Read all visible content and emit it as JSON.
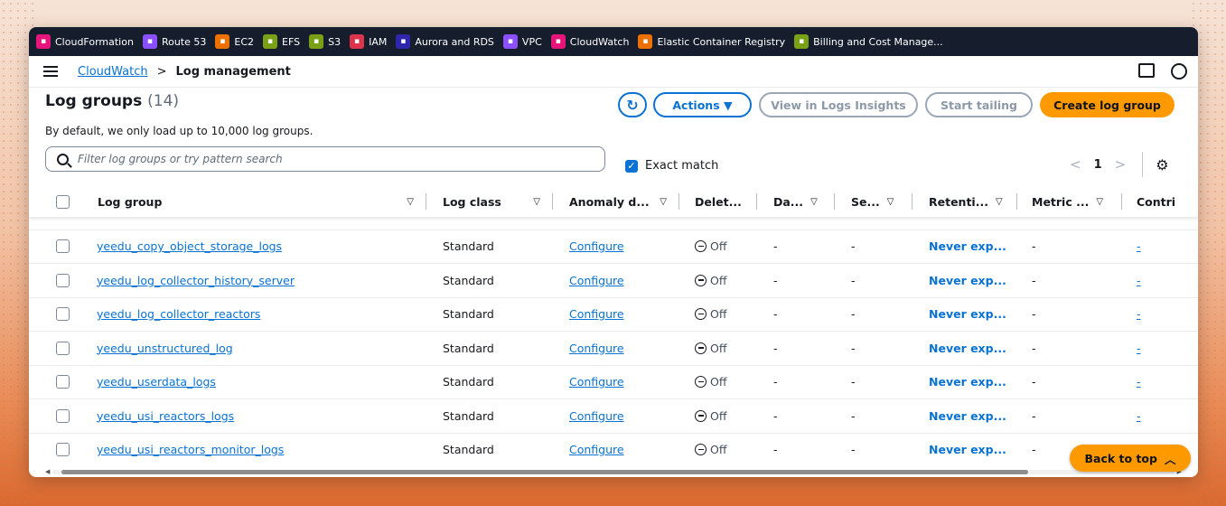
{
  "favorites": [
    {
      "label": "CloudFormation",
      "icon": "cloudformation-icon",
      "color": "#e7157b"
    },
    {
      "label": "Route 53",
      "icon": "route53-icon",
      "color": "#8c4fff"
    },
    {
      "label": "EC2",
      "icon": "ec2-icon",
      "color": "#ed7100"
    },
    {
      "label": "EFS",
      "icon": "efs-icon",
      "color": "#7aa116"
    },
    {
      "label": "S3",
      "icon": "s3-icon",
      "color": "#7aa116"
    },
    {
      "label": "IAM",
      "icon": "iam-icon",
      "color": "#dd344c"
    },
    {
      "label": "Aurora and RDS",
      "icon": "rds-icon",
      "color": "#2e27ad"
    },
    {
      "label": "VPC",
      "icon": "vpc-icon",
      "color": "#8c4fff"
    },
    {
      "label": "CloudWatch",
      "icon": "cloudwatch-icon",
      "color": "#e7157b"
    },
    {
      "label": "Elastic Container Registry",
      "icon": "ecr-icon",
      "color": "#ed7100"
    },
    {
      "label": "Billing and Cost Manage...",
      "icon": "billing-icon",
      "color": "#7aa116"
    }
  ],
  "breadcrumb": {
    "service": "CloudWatch",
    "separator": ">",
    "current": "Log management"
  },
  "header": {
    "title": "Log groups",
    "count": "(14)",
    "description": "By default, we only load up to 10,000 log groups."
  },
  "buttons": {
    "actions": "Actions ▼",
    "insights": "View in Logs Insights",
    "tail": "Start tailing",
    "create": "Create log group"
  },
  "search": {
    "placeholder": "Filter log groups or try pattern search",
    "value": ""
  },
  "exact_match": {
    "label": "Exact match",
    "checked": true
  },
  "pagination": {
    "prev": "<",
    "page": "1",
    "next": ">"
  },
  "columns": [
    "Log group",
    "Log class",
    "Anomaly d...",
    "Delet...",
    "Da...",
    "Se...",
    "Retenti...",
    "Metric ...",
    "Contri"
  ],
  "rows": [
    {
      "name": "yeedu_copy_object_storage_logs",
      "log_class": "Standard",
      "anomaly": "Configure",
      "deletion": "Off",
      "da": "-",
      "se": "-",
      "retention": "Never exp...",
      "metric": "-",
      "contrib": "-"
    },
    {
      "name": "yeedu_log_collector_history_server",
      "log_class": "Standard",
      "anomaly": "Configure",
      "deletion": "Off",
      "da": "-",
      "se": "-",
      "retention": "Never exp...",
      "metric": "-",
      "contrib": "-"
    },
    {
      "name": "yeedu_log_collector_reactors",
      "log_class": "Standard",
      "anomaly": "Configure",
      "deletion": "Off",
      "da": "-",
      "se": "-",
      "retention": "Never exp...",
      "metric": "-",
      "contrib": "-"
    },
    {
      "name": "yeedu_unstructured_log",
      "log_class": "Standard",
      "anomaly": "Configure",
      "deletion": "Off",
      "da": "-",
      "se": "-",
      "retention": "Never exp...",
      "metric": "-",
      "contrib": "-"
    },
    {
      "name": "yeedu_userdata_logs",
      "log_class": "Standard",
      "anomaly": "Configure",
      "deletion": "Off",
      "da": "-",
      "se": "-",
      "retention": "Never exp...",
      "metric": "-",
      "contrib": "-"
    },
    {
      "name": "yeedu_usi_reactors_logs",
      "log_class": "Standard",
      "anomaly": "Configure",
      "deletion": "Off",
      "da": "-",
      "se": "-",
      "retention": "Never exp...",
      "metric": "-",
      "contrib": "-"
    },
    {
      "name": "yeedu_usi_reactors_monitor_logs",
      "log_class": "Standard",
      "anomaly": "Configure",
      "deletion": "Off",
      "da": "-",
      "se": "-",
      "retention": "Never exp...",
      "metric": "-",
      "contrib": "-"
    }
  ],
  "back_to_top": "Back to top"
}
